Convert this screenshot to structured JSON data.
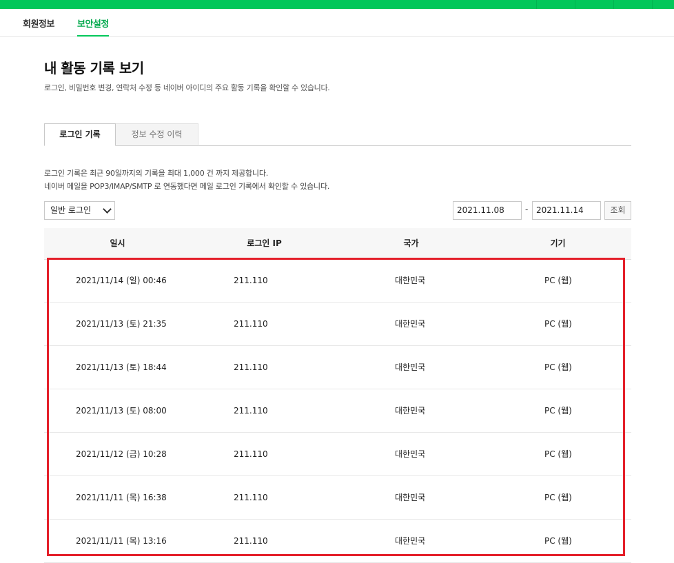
{
  "nav": {
    "tabs": [
      {
        "label": "회원정보",
        "active": false
      },
      {
        "label": "보안설정",
        "active": true
      }
    ]
  },
  "page": {
    "title": "내 활동 기록 보기",
    "description": "로그인, 비밀번호 변경, 연락처 수정 등 네이버 아이디의 주요 활동 기록을 확인할 수 있습니다."
  },
  "subtabs": [
    {
      "label": "로그인 기록",
      "active": true
    },
    {
      "label": "정보 수정 이력",
      "active": false
    }
  ],
  "notice": {
    "line1": "로그인 기록은 최근 90일까지의 기록을 최대 1,000 건 까지 제공합니다.",
    "line2": "네이버 메일을 POP3/IMAP/SMTP 로 연동했다면 메일 로그인 기록에서 확인할 수 있습니다."
  },
  "filter": {
    "login_type": "일반 로그인",
    "date_from": "2021.11.08",
    "date_sep": "-",
    "date_to": "2021.11.14",
    "query_label": "조회"
  },
  "table": {
    "headers": [
      "일시",
      "로그인 IP",
      "국가",
      "기기"
    ],
    "rows": [
      {
        "datetime": "2021/11/14 (일) 00:46",
        "ip": "211.110",
        "country": "대한민국",
        "device": "PC (웹)"
      },
      {
        "datetime": "2021/11/13 (토) 21:35",
        "ip": "211.110",
        "country": "대한민국",
        "device": "PC (웹)"
      },
      {
        "datetime": "2021/11/13 (토) 18:44",
        "ip": "211.110",
        "country": "대한민국",
        "device": "PC (웹)"
      },
      {
        "datetime": "2021/11/13 (토) 08:00",
        "ip": "211.110",
        "country": "대한민국",
        "device": "PC (웹)"
      },
      {
        "datetime": "2021/11/12 (금) 10:28",
        "ip": "211.110",
        "country": "대한민국",
        "device": "PC (웹)"
      },
      {
        "datetime": "2021/11/11 (목) 16:38",
        "ip": "211.110",
        "country": "대한민국",
        "device": "PC (웹)"
      },
      {
        "datetime": "2021/11/11 (목) 13:16",
        "ip": "211.110",
        "country": "대한민국",
        "device": "PC (웹)"
      }
    ]
  },
  "colors": {
    "brand_green": "#03c75a",
    "active_tab_text": "#03a94d",
    "highlight_red": "#e4202a"
  }
}
